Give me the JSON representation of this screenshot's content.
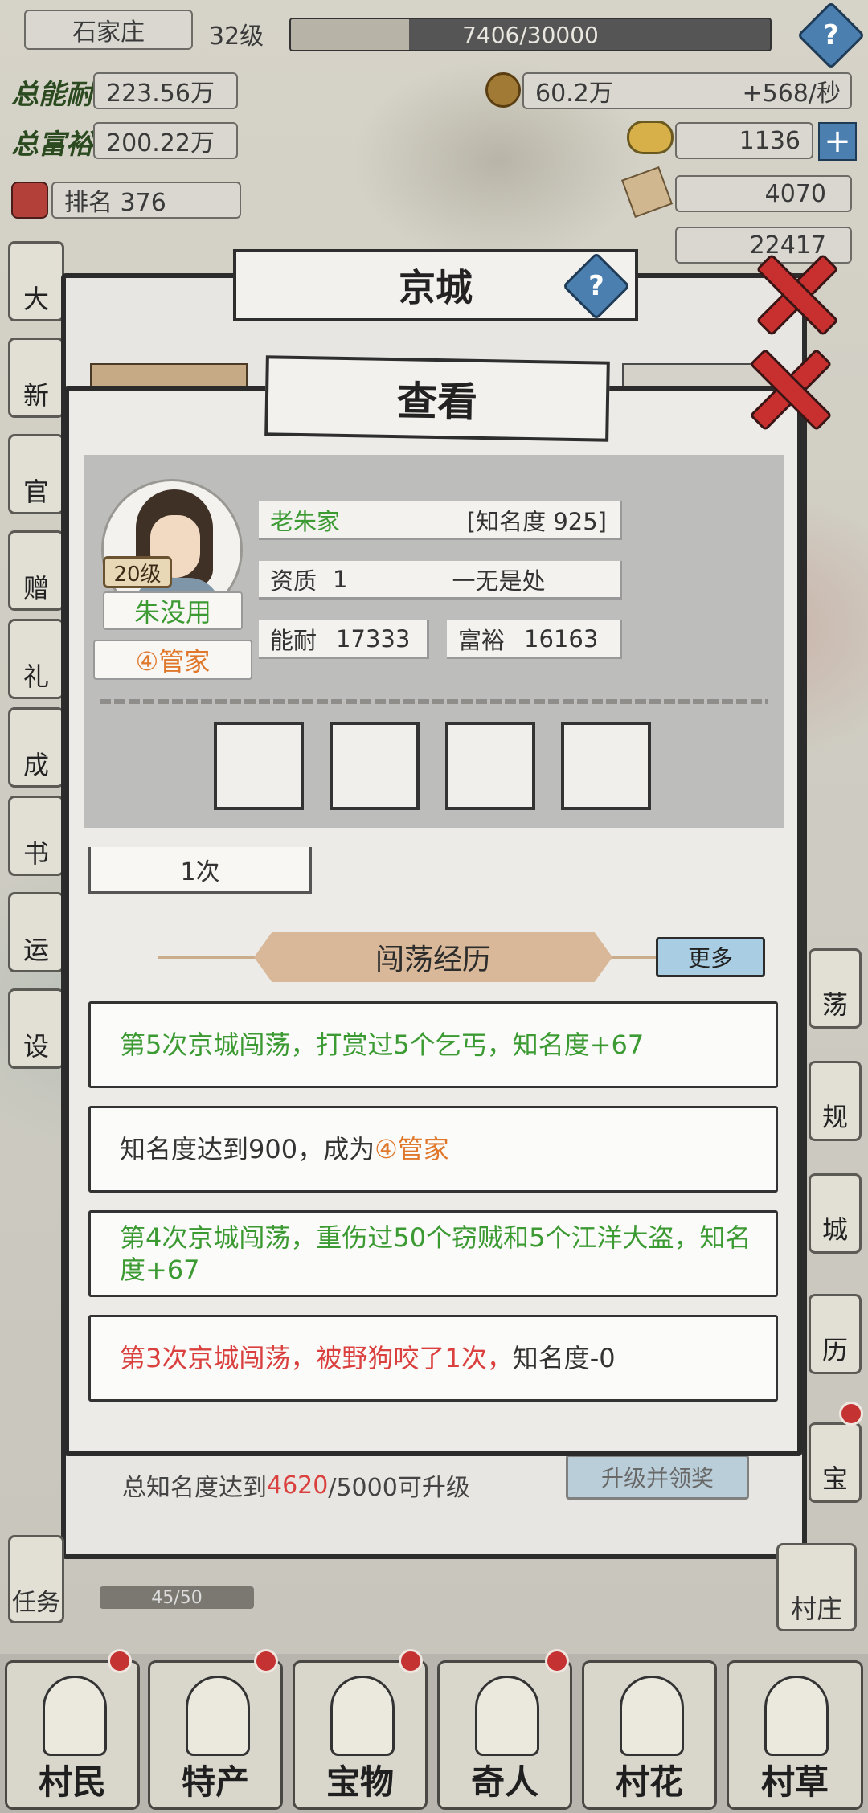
{
  "hud": {
    "city": "石家庄",
    "level": "32级",
    "xp": "7406/30000",
    "xp_fraction": 0.247,
    "stat1_label": "总能耐",
    "stat1_value": "223.56万",
    "stat2_label": "总富裕",
    "stat2_value": "200.22万",
    "rank": "排名 376",
    "coins": "60.2万",
    "coin_rate": "+568/秒",
    "gold": "1136",
    "tickets": "4070",
    "silver": "22417"
  },
  "back_dialog": {
    "title": "京城"
  },
  "front_dialog": {
    "title": "查看",
    "character": {
      "level_badge": "20级",
      "name": "朱没用",
      "rank_title": "④管家",
      "family": "老朱家",
      "fame": "[知名度 925]",
      "aptitude_label": "资质",
      "aptitude_value": "1",
      "aptitude_desc": "一无是处",
      "ability_label": "能耐",
      "ability_value": "17333",
      "wealth_label": "富裕",
      "wealth_value": "16163"
    },
    "count_value": "1次",
    "section_title": "闯荡经历",
    "more_label": "更多",
    "experiences": [
      {
        "text": "第5次京城闯荡，打赏过5个乞丐，知名度+67",
        "color": "green"
      },
      {
        "text_a": "知名度达到900，成为",
        "text_b": "④管家"
      },
      {
        "text": "第4次京城闯荡，重伤过50个窃贼和5个江洋大盗，知名度+67",
        "color": "green"
      },
      {
        "text_a": "第3次京城闯荡，被野狗咬了1次，",
        "text_b": "知名度-0"
      }
    ]
  },
  "upgrade": {
    "prefix": "总知名度达到",
    "current": "4620",
    "suffix": "/5000可升级",
    "button": "升级并领奖"
  },
  "side_tabs_right": [
    "荡",
    "规",
    "城",
    "历",
    "宝",
    "村庄"
  ],
  "side_tabs_left": [
    "大",
    "新",
    "官",
    "赠",
    "礼",
    "成",
    "书",
    "运",
    "设",
    "任务"
  ],
  "quest_progress": "45/50",
  "bottom_nav": [
    "村民",
    "特产",
    "宝物",
    "奇人",
    "村花",
    "村草"
  ],
  "colors": {
    "green_text": "#3c9a33",
    "red_text": "#d9403e",
    "orange_text": "#e0782c",
    "close_red": "#c8302f",
    "help_blue": "#4b7fb0"
  }
}
